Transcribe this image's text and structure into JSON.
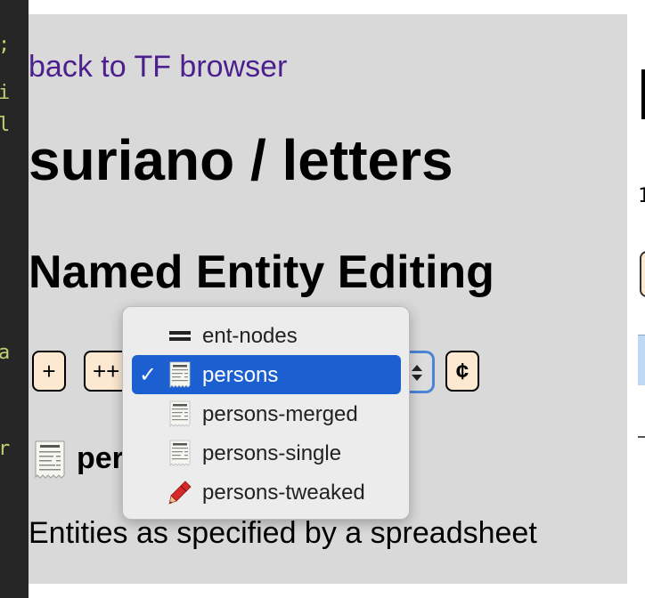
{
  "editor_margin": {
    "chars": [
      ";",
      "i",
      "l",
      "a",
      "r"
    ]
  },
  "right_panel": {
    "glyph_one": "1"
  },
  "page": {
    "back_link": "back to TF browser",
    "title": "suriano / letters",
    "subtitle": "Named Entity Editing"
  },
  "toolbar": {
    "add_label": "+",
    "add_all_label": "++",
    "cent_label": "¢"
  },
  "entity_set": {
    "visible_name": "per",
    "description": "Entities as specified by a spreadsheet"
  },
  "dropdown": {
    "selected": "persons",
    "options": [
      {
        "label": "ent-nodes",
        "icon": "equals-icon"
      },
      {
        "label": "persons",
        "icon": "receipt-icon",
        "checked": true
      },
      {
        "label": "persons-merged",
        "icon": "receipt-icon"
      },
      {
        "label": "persons-single",
        "icon": "receipt-icon"
      },
      {
        "label": "persons-tweaked",
        "icon": "crayon-icon"
      }
    ]
  },
  "colors": {
    "panel_bg": "#d9d9d9",
    "button_bg": "#fde8d2",
    "link": "#4b1f8e",
    "menu_highlight": "#1b5fd0",
    "select_focus": "#4b83d6"
  }
}
